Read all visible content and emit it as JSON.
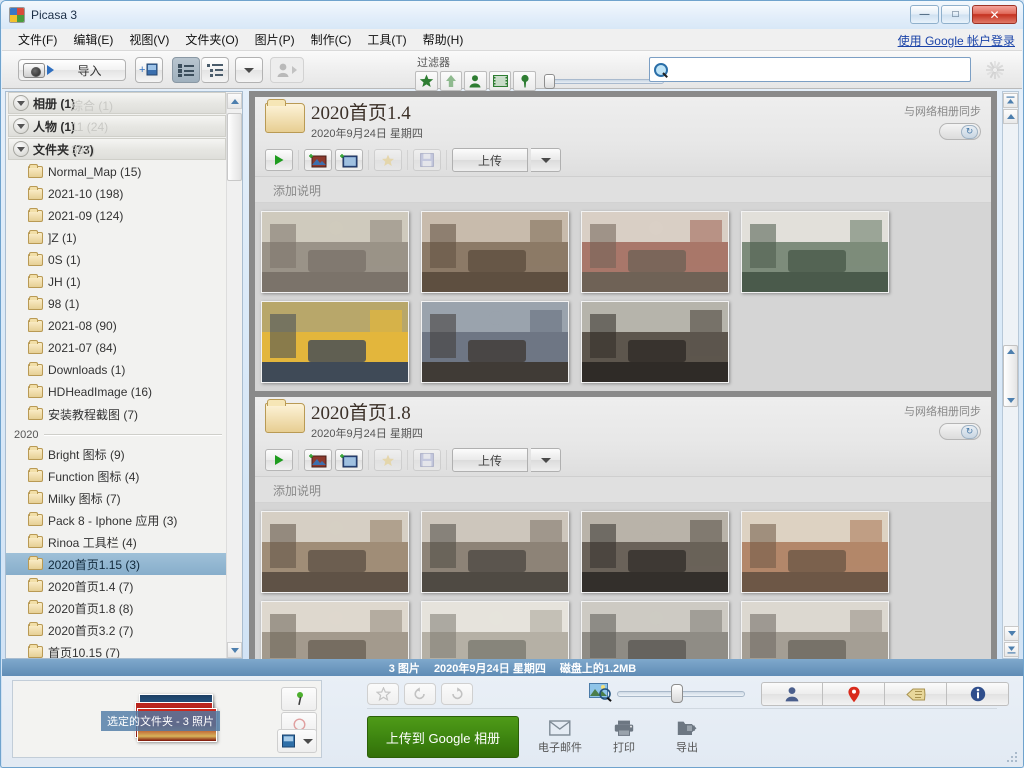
{
  "window": {
    "title": "Picasa 3",
    "minimize": "—",
    "maximize": "□",
    "close": "✕"
  },
  "menu": {
    "items": [
      {
        "label": "文件(F)",
        "name": "menu-file"
      },
      {
        "label": "编辑(E)",
        "name": "menu-edit"
      },
      {
        "label": "视图(V)",
        "name": "menu-view"
      },
      {
        "label": "文件夹(O)",
        "name": "menu-folder"
      },
      {
        "label": "图片(P)",
        "name": "menu-picture"
      },
      {
        "label": "制作(C)",
        "name": "menu-create"
      },
      {
        "label": "工具(T)",
        "name": "menu-tools"
      },
      {
        "label": "帮助(H)",
        "name": "menu-help"
      }
    ],
    "google_login": "使用 Google 帐户登录"
  },
  "toolbar": {
    "import_label": "导入",
    "filter_label": "过滤器",
    "search_placeholder": "",
    "search_value": ""
  },
  "sidebar": {
    "headers": [
      {
        "label": "相册 (1)",
        "ghost": "综合 (1)"
      },
      {
        "label": "人物 (1)",
        "ghost": "11 (24)"
      },
      {
        "label": "文件夹 (73)",
        "ghost": "367)"
      }
    ],
    "groups": [
      {
        "year": "",
        "items": [
          {
            "label": "Normal_Map (15)"
          },
          {
            "label": "2021-10 (198)"
          },
          {
            "label": "2021-09 (124)"
          },
          {
            "label": "]Z (1)"
          },
          {
            "label": "0S (1)"
          },
          {
            "label": "JH (1)"
          },
          {
            "label": "98 (1)"
          },
          {
            "label": "2021-08 (90)"
          },
          {
            "label": "2021-07 (84)"
          },
          {
            "label": "Downloads (1)"
          },
          {
            "label": "HDHeadImage (16)"
          },
          {
            "label": "安装教程截图 (7)"
          }
        ]
      },
      {
        "year": "2020",
        "items": [
          {
            "label": "Bright 图标 (9)"
          },
          {
            "label": "Function 图标 (4)"
          },
          {
            "label": "Milky 图标 (7)"
          },
          {
            "label": "Pack 8 - Iphone 应用 (3)"
          },
          {
            "label": "Rinoa 工具栏 (4)"
          },
          {
            "label": "2020首页1.15 (3)",
            "selected": true
          },
          {
            "label": "2020首页1.4 (7)"
          },
          {
            "label": "2020首页1.8 (8)"
          },
          {
            "label": "2020首页3.2 (7)"
          },
          {
            "label": "首页10.15 (7)"
          }
        ]
      }
    ]
  },
  "content": {
    "folders": [
      {
        "title": "2020首页1.4",
        "date": "2020年9月24日 星期四",
        "sync_label": "与网络相册同步",
        "upload_label": "上传",
        "caption_placeholder": "添加说明",
        "thumbs": [
          {
            "alt": "living-room-marble",
            "c1": "#cfcabd",
            "c2": "#9a9388",
            "c3": "#7b736a"
          },
          {
            "alt": "living-room-mountain-art",
            "c1": "#c8bbac",
            "c2": "#8c7a67",
            "c3": "#5e4f40"
          },
          {
            "alt": "living-room-terracotta",
            "c1": "#d9cfc5",
            "c2": "#a9776a",
            "c3": "#6f6256"
          },
          {
            "alt": "bedroom-green",
            "c1": "#e2e0da",
            "c2": "#7d8c7b",
            "c3": "#4a5a4b"
          },
          {
            "alt": "cafe-yellow-chairs",
            "c1": "#b8a76a",
            "c2": "#e3b63c",
            "c3": "#3f4a57"
          },
          {
            "alt": "library-room-plants",
            "c1": "#9aa3ad",
            "c2": "#6e7684",
            "c3": "#403b36"
          },
          {
            "alt": "bookshelf-lounge",
            "c1": "#b6b4ab",
            "c2": "#5d564d",
            "c3": "#2f2b27"
          }
        ]
      },
      {
        "title": "2020首页1.8",
        "date": "2020年9月24日 星期四",
        "sync_label": "与网络相册同步",
        "upload_label": "上传",
        "caption_placeholder": "添加说明",
        "thumbs": [
          {
            "alt": "classic-living-room",
            "c1": "#d6cfc4",
            "c2": "#a08d77",
            "c3": "#5f5246"
          },
          {
            "alt": "modern-grey-sofa",
            "c1": "#cdc6bc",
            "c2": "#8d8377",
            "c3": "#4f4a43"
          },
          {
            "alt": "dark-shelf-lounge",
            "c1": "#b9b3a9",
            "c2": "#6a6259",
            "c3": "#332f2b"
          },
          {
            "alt": "warm-reading-nook",
            "c1": "#ddd2c2",
            "c2": "#b3876a",
            "c3": "#6d5746"
          },
          {
            "alt": "marble-hall",
            "c1": "#ded8ce",
            "c2": "#a39a8d",
            "c3": "#6a6256"
          },
          {
            "alt": "white-room-plant",
            "c1": "#e6e3dc",
            "c2": "#b5b0a5",
            "c3": "#7c7a71"
          },
          {
            "alt": "grey-corridor",
            "c1": "#cdcac3",
            "c2": "#8f8c85",
            "c3": "#5b5954"
          },
          {
            "alt": "fireplace-mirror",
            "c1": "#dcd8d0",
            "c2": "#a49e94",
            "c3": "#6b665e"
          }
        ]
      }
    ]
  },
  "status": {
    "count": "3 图片",
    "date": "2020年9月24日 星期四",
    "size": "磁盘上的1.2MB"
  },
  "bottom": {
    "tray_badge": "选定的文件夹 - 3 照片",
    "upload_google": "上传到 Google 相册",
    "actions": [
      {
        "label": "电子邮件",
        "name": "email-button",
        "icon": "envelope-icon"
      },
      {
        "label": "打印",
        "name": "print-button",
        "icon": "printer-icon"
      },
      {
        "label": "导出",
        "name": "export-button",
        "icon": "export-icon"
      }
    ],
    "right_buttons": [
      {
        "name": "people-view-button",
        "icon": "person-icon"
      },
      {
        "name": "places-view-button",
        "icon": "map-pin-icon"
      },
      {
        "name": "tags-view-button",
        "icon": "tag-icon"
      },
      {
        "name": "properties-button",
        "icon": "info-icon"
      }
    ]
  },
  "colors": {
    "accent": "#5f8cb5",
    "google_green": "#3d8410",
    "link": "#1a43a8",
    "selection": "#87aecb"
  }
}
